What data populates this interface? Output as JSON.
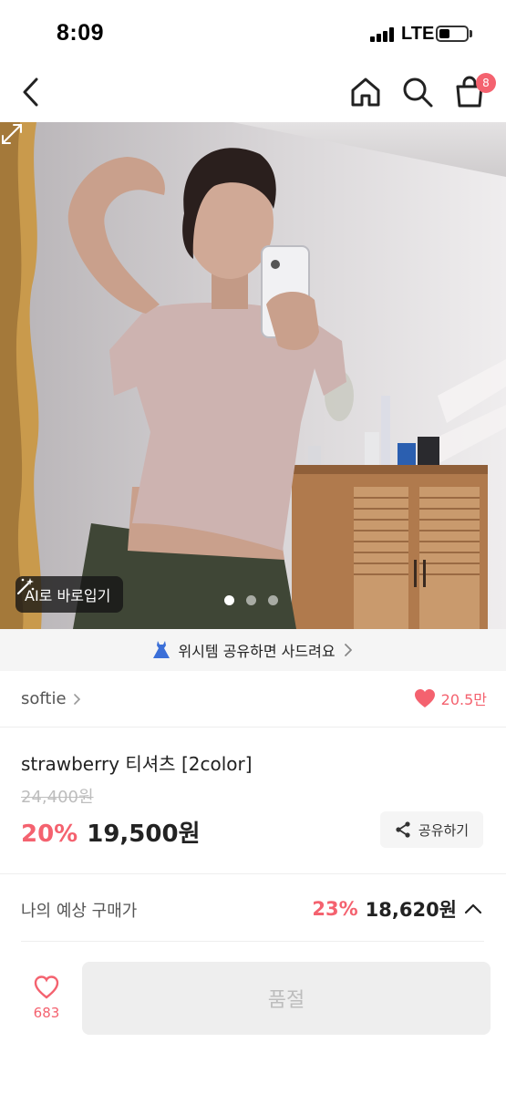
{
  "status_bar": {
    "time": "8:09",
    "network": "LTE"
  },
  "nav": {
    "cart_badge": "8"
  },
  "hero": {
    "ai_button_label": "AI로 바로입기",
    "page_count": 3,
    "active_page": 1
  },
  "wish_banner": {
    "text": "위시템 공유하면 사드려요"
  },
  "store": {
    "name": "softie",
    "likes": "20.5만"
  },
  "product": {
    "title": "strawberry 티셔츠 [2color]",
    "original_price": "24,400원",
    "discount": "20%",
    "price": "19,500원",
    "share_label": "공유하기"
  },
  "expected": {
    "label": "나의 예상 구매가",
    "discount": "23%",
    "price": "18,620원"
  },
  "bottom": {
    "wish_count": "683",
    "soldout_label": "품절"
  },
  "colors": {
    "accent": "#f4626f",
    "text": "#222222",
    "muted": "#bdbdbd",
    "surface": "#f5f5f5"
  }
}
